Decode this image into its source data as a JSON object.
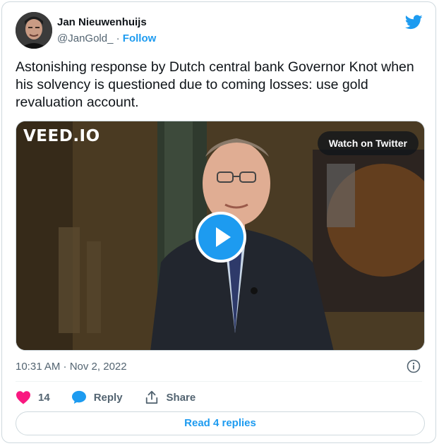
{
  "author": {
    "name": "Jan Nieuwenhuijs",
    "handle": "@JanGold_",
    "separator": "·",
    "follow_label": "Follow"
  },
  "tweet": {
    "text": "Astonishing response by Dutch central bank Governor Knot when his solvency is questioned due to coming losses: use gold revaluation account."
  },
  "media": {
    "watermark": "VEED.IO",
    "watch_label": "Watch on Twitter",
    "play_icon": "play-icon"
  },
  "meta": {
    "timestamp": "10:31 AM · Nov 2, 2022",
    "info_icon": "info-icon"
  },
  "actions": {
    "like_count": "14",
    "reply_label": "Reply",
    "share_label": "Share",
    "read_replies_label": "Read 4 replies"
  },
  "colors": {
    "accent": "#1d9bf0",
    "like": "#f91880",
    "muted_text": "#536471",
    "border": "#cfd9de"
  }
}
